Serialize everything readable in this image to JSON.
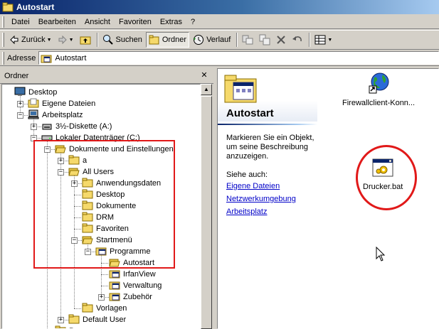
{
  "window": {
    "title": "Autostart"
  },
  "menu": [
    "Datei",
    "Bearbeiten",
    "Ansicht",
    "Favoriten",
    "Extras",
    "?"
  ],
  "toolbar": {
    "back": "Zurück",
    "search": "Suchen",
    "folders": "Ordner",
    "history": "Verlauf"
  },
  "address": {
    "label": "Adresse",
    "value": "Autostart"
  },
  "folder_pane": {
    "title": "Ordner",
    "tree": [
      {
        "label": "Desktop"
      },
      {
        "label": "Eigene Dateien"
      },
      {
        "label": "Arbeitsplatz"
      },
      {
        "label": "3½-Diskette (A:)"
      },
      {
        "label": "Lokaler Datenträger (C:)"
      },
      {
        "label": "Dokumente und Einstellungen"
      },
      {
        "label": "a"
      },
      {
        "label": "All Users"
      },
      {
        "label": "Anwendungsdaten"
      },
      {
        "label": "Desktop"
      },
      {
        "label": "Dokumente"
      },
      {
        "label": "DRM"
      },
      {
        "label": "Favoriten"
      },
      {
        "label": "Startmenü"
      },
      {
        "label": "Programme"
      },
      {
        "label": "Autostart"
      },
      {
        "label": "IrfanView"
      },
      {
        "label": "Verwaltung"
      },
      {
        "label": "Zubehör"
      },
      {
        "label": "Vorlagen"
      },
      {
        "label": "Default User"
      },
      {
        "label": "Programme"
      }
    ]
  },
  "info_panel": {
    "folder_title": "Autostart",
    "description": "Markieren Sie ein Objekt, um seine Beschreibung anzuzeigen.",
    "see_also": "Siehe auch:",
    "links": [
      "Eigene Dateien",
      "Netzwerkumgebung",
      "Arbeitsplatz"
    ]
  },
  "files": [
    {
      "name": "Firewallclient-Konn...",
      "icon": "globe-shortcut-icon"
    },
    {
      "name": "Drucker.bat",
      "icon": "batch-file-icon"
    }
  ],
  "colors": {
    "title_active": "#0a246a",
    "annotation": "#e11919",
    "link": "#0000c8",
    "window_face": "#d4d0c8"
  }
}
